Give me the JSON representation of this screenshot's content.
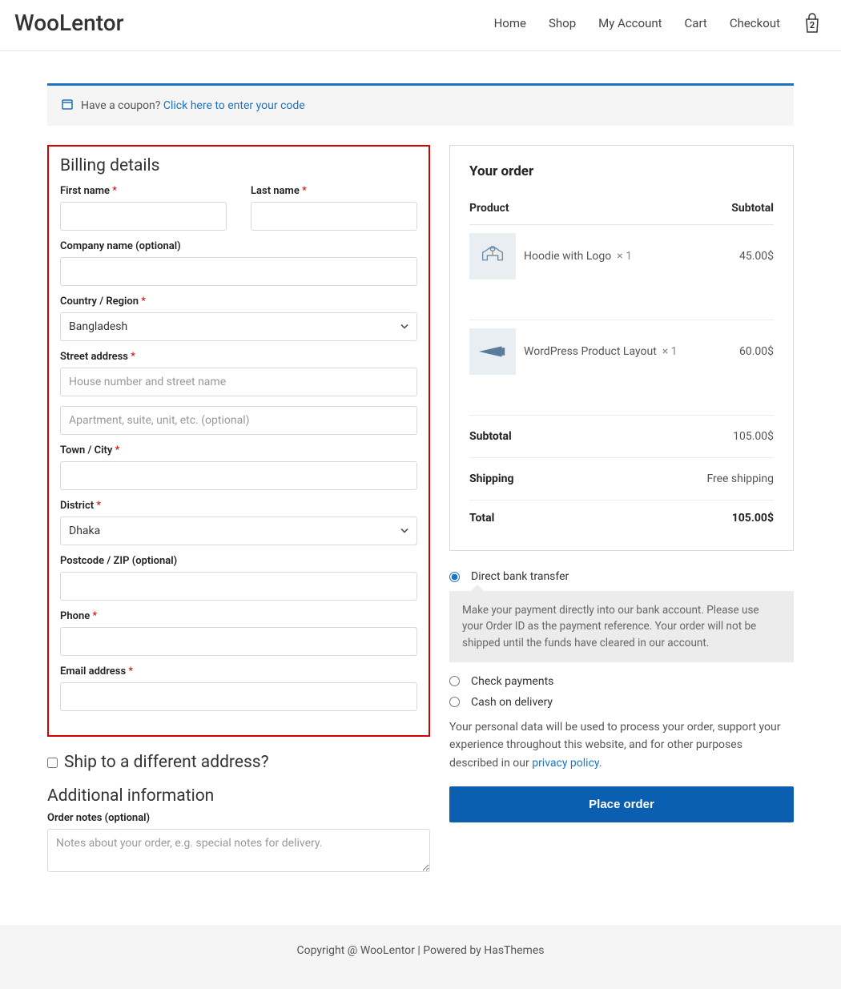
{
  "header": {
    "brand": "WooLentor",
    "nav": [
      "Home",
      "Shop",
      "My Account",
      "Cart",
      "Checkout"
    ],
    "cart_count": "2"
  },
  "coupon": {
    "prompt": "Have a coupon?",
    "link": "Click here to enter your code"
  },
  "billing": {
    "title": "Billing details",
    "first_name": "First name",
    "last_name": "Last name",
    "company": "Company name (optional)",
    "country": "Country / Region",
    "country_value": "Bangladesh",
    "street": "Street address",
    "street_ph1": "House number and street name",
    "street_ph2": "Apartment, suite, unit, etc. (optional)",
    "city": "Town / City",
    "district": "District",
    "district_value": "Dhaka",
    "postcode": "Postcode / ZIP (optional)",
    "phone": "Phone",
    "email": "Email address"
  },
  "ship_diff": "Ship to a different address?",
  "additional": {
    "title": "Additional information",
    "notes_label": "Order notes (optional)",
    "notes_ph": "Notes about your order, e.g. special notes for delivery."
  },
  "order": {
    "title": "Your order",
    "head_product": "Product",
    "head_subtotal": "Subtotal",
    "items": [
      {
        "name": "Hoodie with Logo",
        "qty": "× 1",
        "price": "45.00$"
      },
      {
        "name": "WordPress Product Layout",
        "qty": "× 1",
        "price": "60.00$"
      }
    ],
    "subtotal_label": "Subtotal",
    "subtotal_value": "105.00$",
    "shipping_label": "Shipping",
    "shipping_value": "Free shipping",
    "total_label": "Total",
    "total_value": "105.00$"
  },
  "payment": {
    "options": [
      "Direct bank transfer",
      "Check payments",
      "Cash on delivery"
    ],
    "desc": "Make your payment directly into our bank account. Please use your Order ID as the payment reference. Your order will not be shipped until the funds have cleared in our account."
  },
  "privacy": {
    "text": "Your personal data will be used to process your order, support your experience throughout this website, and for other purposes described in our ",
    "link": "privacy policy"
  },
  "place_order": "Place order",
  "footer": "Copyright @ WooLentor | Powered by HasThemes"
}
